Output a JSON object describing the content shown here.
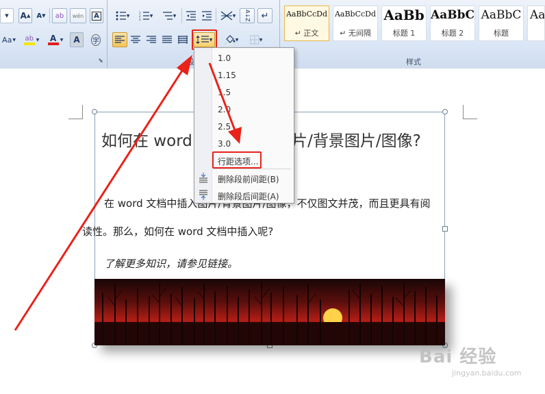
{
  "ribbon": {
    "font_group": {
      "grow_font": "A",
      "shrink_font": "A",
      "clear_format_glyph": "ab",
      "phonetic_glyph": "wén",
      "char_border": "A",
      "font_dropdown_prefix": "Aa",
      "highlight_glyph": "ab",
      "font_color_glyph": "A",
      "shading_glyph": "A",
      "enclose_glyph": "字"
    },
    "paragraph_group": {
      "label": "段落",
      "sort_glyph": "A↓Z"
    },
    "styles_group": {
      "label": "样式",
      "tiles": [
        {
          "sample": "AaBbCcDd",
          "name": "↵ 正文"
        },
        {
          "sample": "AaBbCcDd",
          "name": "↵ 无间隔"
        },
        {
          "sample": "AaBb",
          "name": "标题 1"
        },
        {
          "sample": "AaBbC",
          "name": "标题 2"
        },
        {
          "sample": "AaBbC",
          "name": "标题"
        },
        {
          "sample": "Aa",
          "name": ""
        }
      ]
    },
    "colors": {
      "highlight_yellow": "#f5e400",
      "font_red": "#e11d1d",
      "outline_red": "#e8231a"
    }
  },
  "menu": {
    "items": [
      "1.0",
      "1.15",
      "1.5",
      "2.0",
      "2.5",
      "3.0"
    ],
    "line_options": "行距选项...",
    "remove_before": "删除段前间距(B)",
    "remove_after": "删除段后间距(A)"
  },
  "document": {
    "title": "如何在 word 文档中插入图片/背景图片/图像?",
    "para1": "在 word 文档中插入图片/背景图片/图像，不仅图文并茂，而且更具有阅",
    "para2": "读性。那么，如何在 word 文档中插入呢?",
    "para3": "了解更多知识，请参见链接。"
  },
  "watermark": {
    "brand": "Bai 经验",
    "url": "jingyan.baidu.com"
  }
}
